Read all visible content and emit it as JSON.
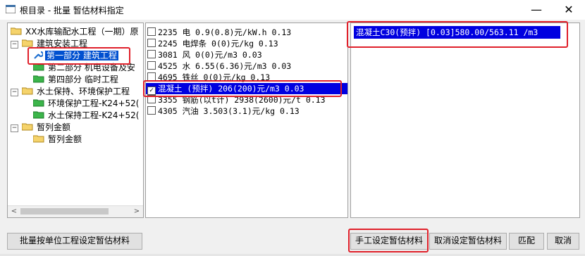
{
  "window": {
    "title": "根目录 - 批量 暂估材料指定",
    "minimize_glyph": "—",
    "maximize_glyph": "☐",
    "close_glyph": "✕"
  },
  "tree": {
    "nodes": [
      {
        "label": "XX水库输配水工程（一期）原"
      },
      {
        "label": "建筑安装工程"
      },
      {
        "label": "第一部分 建筑工程"
      },
      {
        "label": "第二部分 机电设备及安"
      },
      {
        "label": "第四部分 临时工程"
      },
      {
        "label": "水土保持、环境保护工程"
      },
      {
        "label": "环境保护工程-K24+52("
      },
      {
        "label": "水土保持工程-K24+52("
      },
      {
        "label": "暂列金额"
      },
      {
        "label": "暂列金额"
      }
    ],
    "collapse_glyph": "−",
    "scroll_left": "<",
    "scroll_right": ">"
  },
  "materials": [
    {
      "text": "2235 电 0.9(0.8)元/kW.h 0.13",
      "checked": false
    },
    {
      "text": "2245 电焊条 0(0)元/kg 0.13",
      "checked": false
    },
    {
      "text": "3081 风 0(0)元/m3 0.03",
      "checked": false
    },
    {
      "text": "4525 水 6.55(6.36)元/m3 0.03",
      "checked": false
    },
    {
      "text": "4695 铁丝 0(0)元/kg 0.13",
      "checked": false
    },
    {
      "text": "混凝土 (预拌)  206(200)元/m3 0.03",
      "checked": true
    },
    {
      "text": "3355 钢筋(以t计) 2938(2600)元/t 0.13",
      "checked": false
    },
    {
      "text": "4305 汽油 3.503(3.1)元/kg 0.13",
      "checked": false
    }
  ],
  "assigned": {
    "row": "混凝土C30(预拌)  [0.03]580.00/563.11 /m3"
  },
  "buttons": {
    "batch": "批量按单位工程设定暂估材料",
    "manual": "手工设定暂估材料",
    "cancel_set": "取消设定暂估材料",
    "match": "匹配",
    "cancel": "取消"
  },
  "colors": {
    "selection": "#0050d0",
    "highlight_row": "#0000e0",
    "annotation_red": "#e0202a"
  }
}
